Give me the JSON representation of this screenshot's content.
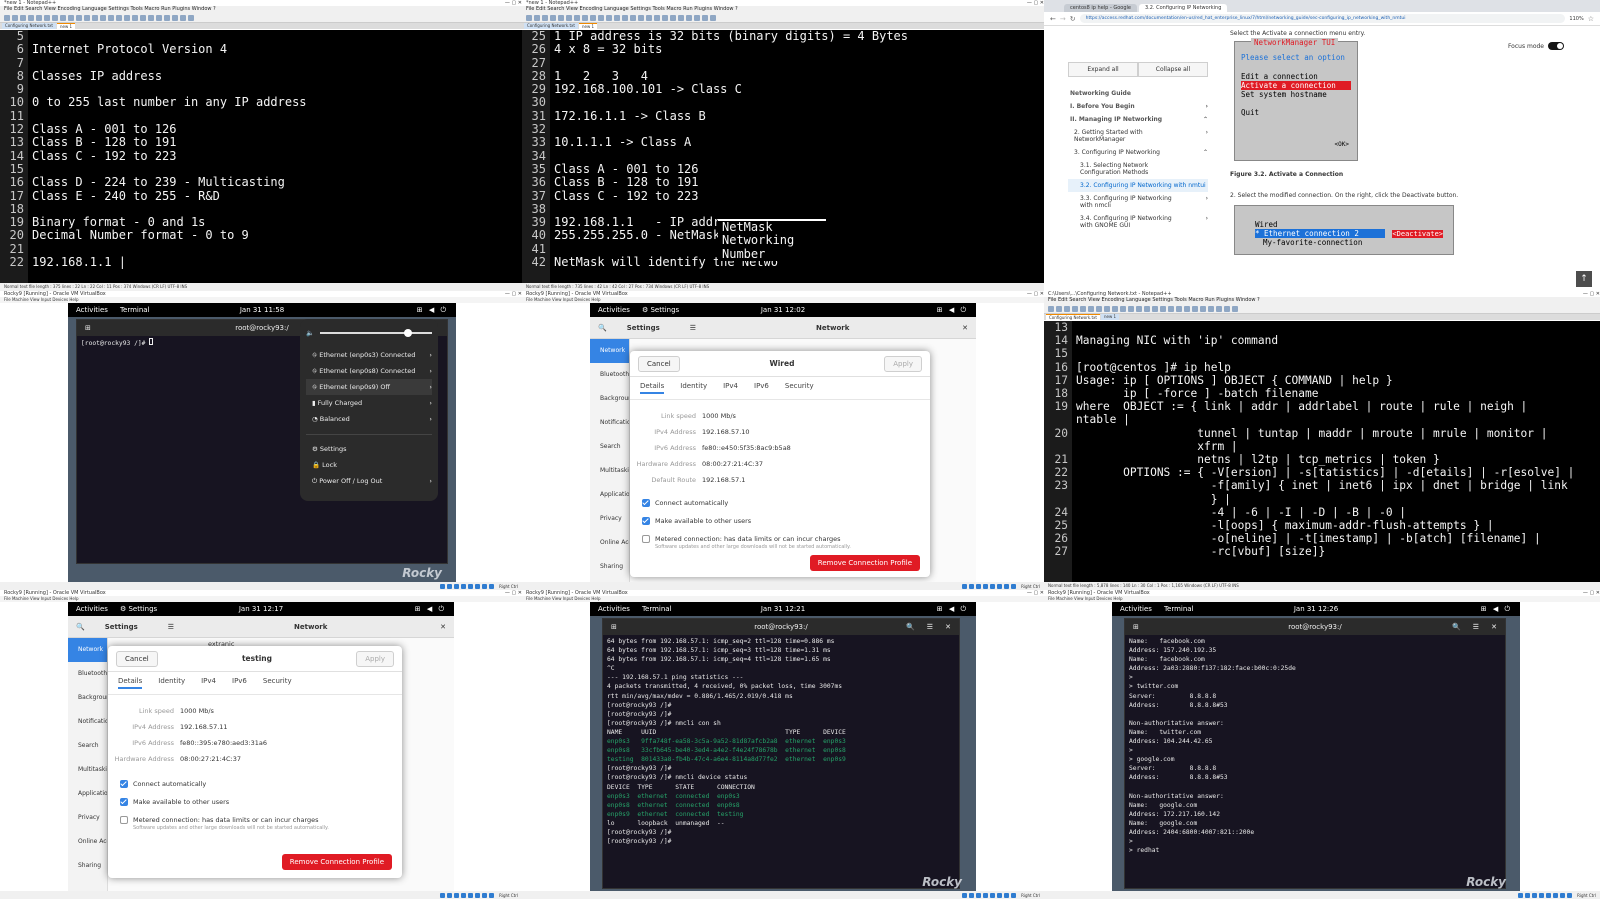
{
  "tile1": {
    "window_title": "*new 1 - Notepad++",
    "menu": "File  Edit  Search  View  Encoding  Language  Settings  Tools  Macro  Run  Plugins  Window  ?",
    "tabs": [
      "Configuring Network.txt",
      "new 1"
    ],
    "status": "Normal text file        length : 375   lines : 22        Ln : 22   Col : 11   Pos : 374        Windows (CR LF)    UTF-8    INS",
    "lines": [
      {
        "n": "5",
        "t": ""
      },
      {
        "n": "6",
        "t": "Internet Protocol Version 4"
      },
      {
        "n": "7",
        "t": ""
      },
      {
        "n": "8",
        "t": "Classes IP address"
      },
      {
        "n": "9",
        "t": ""
      },
      {
        "n": "10",
        "t": "0 to 255 last number in any IP address"
      },
      {
        "n": "11",
        "t": ""
      },
      {
        "n": "12",
        "t": "Class A - 001 to 126"
      },
      {
        "n": "13",
        "t": "Class B - 128 to 191"
      },
      {
        "n": "14",
        "t": "Class C - 192 to 223"
      },
      {
        "n": "15",
        "t": ""
      },
      {
        "n": "16",
        "t": "Class D - 224 to 239 - Multicasting"
      },
      {
        "n": "17",
        "t": "Class E - 240 to 255 - R&D"
      },
      {
        "n": "18",
        "t": ""
      },
      {
        "n": "19",
        "t": "Binary format - 0 and 1s"
      },
      {
        "n": "20",
        "t": "Decimal Number format - 0 to 9"
      },
      {
        "n": "21",
        "t": ""
      },
      {
        "n": "22",
        "t": "192.168.1.1 |"
      }
    ]
  },
  "tile2": {
    "window_title": "*new 1 - Notepad++",
    "menu": "File  Edit  Search  View  Encoding  Language  Settings  Tools  Macro  Run  Plugins  Window  ?",
    "tabs": [
      "Configuring Network.txt",
      "new 1"
    ],
    "status": "Normal text file        length : 735   lines : 42        Ln : 42   Col : 27   Pos : 734        Windows (CR LF)    UTF-8    INS",
    "lines": [
      {
        "n": "25",
        "t": "1 IP address is 32 bits (binary digits) = 4 Bytes"
      },
      {
        "n": "26",
        "t": "4 x 8 = 32 bits"
      },
      {
        "n": "27",
        "t": ""
      },
      {
        "n": "28",
        "t": "1   2   3   4"
      },
      {
        "n": "29",
        "t": "192.168.100.101 -> Class C"
      },
      {
        "n": "30",
        "t": ""
      },
      {
        "n": "31",
        "t": "172.16.1.1 -> Class B"
      },
      {
        "n": "32",
        "t": ""
      },
      {
        "n": "33",
        "t": "10.1.1.1 -> Class A"
      },
      {
        "n": "34",
        "t": ""
      },
      {
        "n": "35",
        "t": "Class A - 001 to 126"
      },
      {
        "n": "36",
        "t": "Class B - 128 to 191"
      },
      {
        "n": "37",
        "t": "Class C - 192 to 223"
      },
      {
        "n": "38",
        "t": ""
      },
      {
        "n": "39",
        "t": "192.168.1.1   - IP addres"
      },
      {
        "n": "40",
        "t": "255.255.255.0 - NetMask"
      },
      {
        "n": "41",
        "t": ""
      },
      {
        "n": "42",
        "t": "NetMask will identify the Netwo"
      }
    ],
    "autocomplete": [
      "NetMask",
      "Networking",
      "Number"
    ]
  },
  "tile3": {
    "tabs": [
      "centos8 ip help - Google",
      "3.2. Configuring IP Networking"
    ],
    "url": "https://access.redhat.com/documentation/en-us/red_hat_enterprise_linux/7/html/networking_guide/sec-configuring_ip_networking_with_nmtui",
    "zoom": "110%",
    "focus_mode": "Focus mode",
    "expand_all": "Expand all",
    "collapse_all": "Collapse all",
    "nav": [
      "Networking Guide",
      "I. Before You Begin",
      "II. Managing IP Networking",
      "2. Getting Started with NetworkManager",
      "3. Configuring IP Networking",
      "3.1. Selecting Network Configuration Methods",
      "3.2. Configuring IP Networking with nmtui",
      "3.3. Configuring IP Networking with nmcli",
      "3.4. Configuring IP Networking with GNOME GUI"
    ],
    "step_top": "Select the  Activate a connection  menu entry.",
    "tui": {
      "title": "NetworkManager TUI",
      "prompt": "Please select an option",
      "items": [
        "Edit a connection",
        "Activate a connection",
        "Set system hostname",
        "",
        "Quit"
      ],
      "ok": "<OK>"
    },
    "figure": "Figure 3.2. Activate a Connection",
    "step2": "2. Select the modified connection. On the right, click the  Deactivate  button.",
    "tui2": {
      "wired": "Wired",
      "selected": "* Ethernet connection 2",
      "other": "My-favorite-connection",
      "deactivate": "<Deactivate>"
    }
  },
  "tile4": {
    "vb_title": "Rocky9 [Running] - Oracle VM VirtualBox",
    "vb_menu": "File   Machine   View   Input   Devices   Help",
    "activities": "Activities",
    "app": "Terminal",
    "clock": "Jan 31  11:58",
    "term_title": "root@rocky93:/",
    "prompt": "[root@rocky93 /]# ",
    "menu": [
      "Ethernet (enp0s3) Connected",
      "Ethernet (enp0s8) Connected",
      "Ethernet (enp0s9) Off",
      "Fully Charged",
      "Balanced",
      "Settings",
      "Lock",
      "Power Off / Log Out"
    ],
    "host_key": "Right Ctrl"
  },
  "tile5": {
    "vb_title": "Rocky9 [Running] - Oracle VM VirtualBox",
    "activities": "Activities",
    "app": "Settings",
    "clock": "Jan 31  12:02",
    "settings_title": "Settings",
    "network_title": "Network",
    "side": [
      "Network",
      "Bluetooth",
      "Background",
      "Notifications",
      "Search",
      "Multitasking",
      "Applications",
      "Privacy",
      "Online Accounts",
      "Sharing"
    ],
    "dialog": {
      "cancel": "Cancel",
      "title": "Wired",
      "apply": "Apply",
      "tabs": [
        "Details",
        "Identity",
        "IPv4",
        "IPv6",
        "Security"
      ],
      "rows": [
        {
          "k": "Link speed",
          "v": "1000 Mb/s"
        },
        {
          "k": "IPv4 Address",
          "v": "192.168.57.10"
        },
        {
          "k": "IPv6 Address",
          "v": "fe80::e450:5f35:8ac9:b5a8"
        },
        {
          "k": "Hardware Address",
          "v": "08:00:27:21:4C:37"
        },
        {
          "k": "Default Route",
          "v": "192.168.57.1"
        }
      ],
      "auto": "Connect automatically",
      "avail": "Make available to other users",
      "metered": "Metered connection: has data limits or can incur charges",
      "metered_sub": "Software updates and other large downloads will not be started automatically.",
      "remove": "Remove Connection Profile"
    }
  },
  "tile6": {
    "window_title": "C:\\Users\\...\\Configuring Network.txt - Notepad++",
    "tabs": [
      "Configuring Network.txt",
      "new 1"
    ],
    "status": "Normal text file        length : 5,878   lines : 140        Ln : 30   Col : 1   Pos : 1,165        Windows (CR LF)    UTF-8    INS",
    "lines": [
      {
        "n": "13",
        "t": ""
      },
      {
        "n": "14",
        "t": "Managing NIC with 'ip' command"
      },
      {
        "n": "15",
        "t": ""
      },
      {
        "n": "16",
        "t": "[root@centos ]# ip help"
      },
      {
        "n": "17",
        "t": "Usage: ip [ OPTIONS ] OBJECT { COMMAND | help }"
      },
      {
        "n": "18",
        "t": "       ip [ -force ] -batch filename"
      },
      {
        "n": "19",
        "t": "where  OBJECT := { link | addr | addrlabel | route | rule | neigh |"
      },
      {
        "n": "",
        "t": "ntable |"
      },
      {
        "n": "20",
        "t": "                  tunnel | tuntap | maddr | mroute | mrule | monitor |"
      },
      {
        "n": "",
        "t": "                  xfrm |"
      },
      {
        "n": "21",
        "t": "                  netns | l2tp | tcp_metrics | token }"
      },
      {
        "n": "22",
        "t": "       OPTIONS := { -V[ersion] | -s[tatistics] | -d[etails] | -r[esolve] |"
      },
      {
        "n": "23",
        "t": "                    -f[amily] { inet | inet6 | ipx | dnet | bridge | link"
      },
      {
        "n": "",
        "t": "                    } |"
      },
      {
        "n": "24",
        "t": "                    -4 | -6 | -I | -D | -B | -0 |"
      },
      {
        "n": "25",
        "t": "                    -l[oops] { maximum-addr-flush-attempts } |"
      },
      {
        "n": "26",
        "t": "                    -o[neline] | -t[imestamp] | -b[atch] [filename] |"
      },
      {
        "n": "27",
        "t": "                    -rc[vbuf] [size]}"
      }
    ]
  },
  "tile7": {
    "activities": "Activities",
    "app": "Settings",
    "clock": "Jan 31  12:17",
    "settings_title": "Settings",
    "network_title": "Network",
    "side": [
      "Network",
      "Bluetooth",
      "Background",
      "Notifications",
      "Search",
      "Multitasking",
      "Applications",
      "Privacy",
      "Online Accounts",
      "Sharing"
    ],
    "extranic": "extranic",
    "dialog": {
      "cancel": "Cancel",
      "title": "testing",
      "apply": "Apply",
      "tabs": [
        "Details",
        "Identity",
        "IPv4",
        "IPv6",
        "Security"
      ],
      "rows": [
        {
          "k": "Link speed",
          "v": "1000 Mb/s"
        },
        {
          "k": "IPv4 Address",
          "v": "192.168.57.11"
        },
        {
          "k": "IPv6 Address",
          "v": "fe80::395:e780:aed3:31a6"
        },
        {
          "k": "Hardware Address",
          "v": "08:00:27:21:4C:37"
        }
      ],
      "auto": "Connect automatically",
      "avail": "Make available to other users",
      "metered": "Metered connection: has data limits or can incur charges",
      "metered_sub": "Software updates and other large downloads will not be started automatically.",
      "remove": "Remove Connection Profile"
    }
  },
  "tile8": {
    "activities": "Activities",
    "app": "Terminal",
    "clock": "Jan 31  12:21",
    "term_title": "root@rocky93:/",
    "lines": [
      {
        "t": "64 bytes from 192.168.57.1: icmp_seq=2 ttl=128 time=0.886 ms",
        "c": ""
      },
      {
        "t": "64 bytes from 192.168.57.1: icmp_seq=3 ttl=128 time=1.31 ms",
        "c": ""
      },
      {
        "t": "64 bytes from 192.168.57.1: icmp_seq=4 ttl=128 time=1.65 ms",
        "c": ""
      },
      {
        "t": "^C",
        "c": ""
      },
      {
        "t": "--- 192.168.57.1 ping statistics ---",
        "c": ""
      },
      {
        "t": "4 packets transmitted, 4 received, 0% packet loss, time 3007ms",
        "c": ""
      },
      {
        "t": "rtt min/avg/max/mdev = 0.886/1.465/2.019/0.418 ms",
        "c": ""
      },
      {
        "t": "[root@rocky93 /]#",
        "c": ""
      },
      {
        "t": "[root@rocky93 /]#",
        "c": ""
      },
      {
        "t": "[root@rocky93 /]# nmcli con sh",
        "c": ""
      },
      {
        "t": "NAME     UUID                                  TYPE      DEVICE",
        "c": ""
      },
      {
        "t": "enp0s3   9ffa748f-ea58-3c5a-9a52-81d87afcb2a8  ethernet  enp0s3",
        "c": "g"
      },
      {
        "t": "enp0s8   33cfb645-be40-3ed4-a4e2-f4e24f78678b  ethernet  enp0s8",
        "c": "g"
      },
      {
        "t": "testing  801433a8-fb4b-47c4-a6e4-8114a8d77fe2  ethernet  enp0s9",
        "c": "g"
      },
      {
        "t": "[root@rocky93 /]#",
        "c": ""
      },
      {
        "t": "[root@rocky93 /]# nmcli device status",
        "c": ""
      },
      {
        "t": "DEVICE  TYPE      STATE      CONNECTION",
        "c": ""
      },
      {
        "t": "enp0s3  ethernet  connected  enp0s3",
        "c": "g"
      },
      {
        "t": "enp0s8  ethernet  connected  enp0s8",
        "c": "g"
      },
      {
        "t": "enp0s9  ethernet  connected  testing",
        "c": "g"
      },
      {
        "t": "lo      loopback  unmanaged  --",
        "c": ""
      },
      {
        "t": "[root@rocky93 /]#",
        "c": ""
      },
      {
        "t": "[root@rocky93 /]#",
        "c": ""
      }
    ]
  },
  "tile9": {
    "activities": "Activities",
    "app": "Terminal",
    "clock": "Jan 31  12:26",
    "term_title": "root@rocky93:/",
    "lines": [
      "Name:   facebook.com",
      "Address: 157.240.192.35",
      "Name:   facebook.com",
      "Address: 2a03:2880:f137:182:face:b00c:0:25de",
      ">",
      "> twitter.com",
      "Server:         8.8.8.8",
      "Address:        8.8.8.8#53",
      "",
      "Non-authoritative answer:",
      "Name:   twitter.com",
      "Address: 104.244.42.65",
      ">",
      "> google.com",
      "Server:         8.8.8.8",
      "Address:        8.8.8.8#53",
      "",
      "Non-authoritative answer:",
      "Name:   google.com",
      "Address: 172.217.160.142",
      "Name:   google.com",
      "Address: 2404:6800:4007:821::200e",
      ">",
      "> redhat"
    ]
  },
  "brand": "Rocky"
}
